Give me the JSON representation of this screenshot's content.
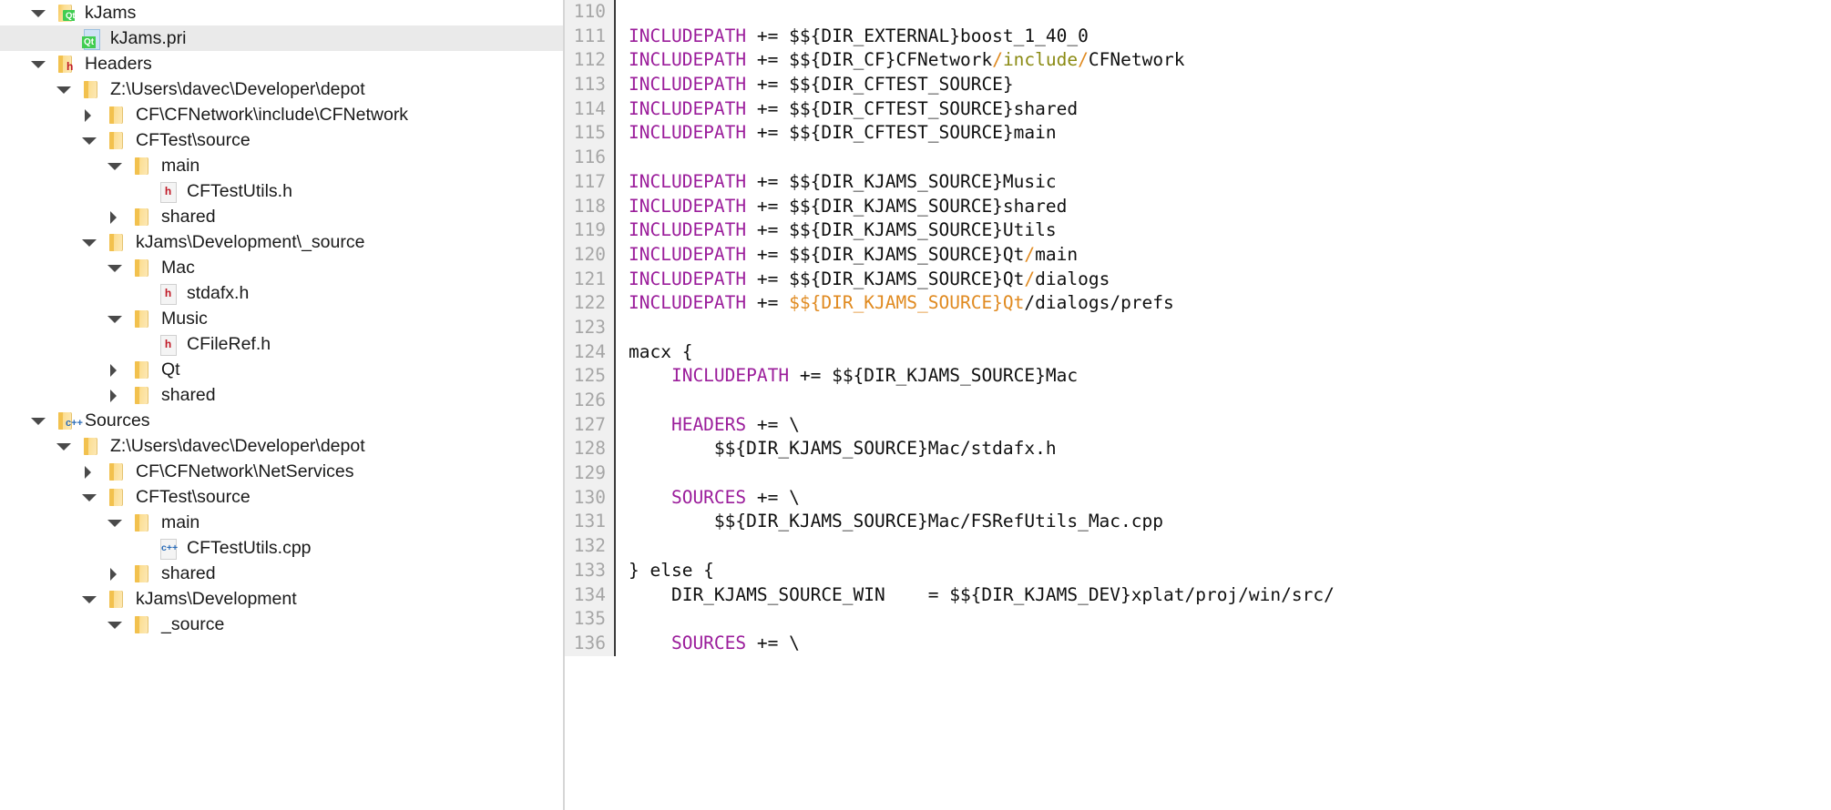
{
  "window": {
    "title": "kJams.pri - Qt Creator project tree and qmake editor"
  },
  "tree": {
    "name": "project-tree",
    "selected_item": "kJams.pri",
    "items": [
      {
        "label": "kJams",
        "depth": 1,
        "twisty": "open",
        "icon": "folder-qt",
        "badge": "Qt",
        "selected": false
      },
      {
        "label": "kJams.pri",
        "depth": 2,
        "twisty": "none",
        "icon": "file-qt",
        "badge": "Qt",
        "selected": true
      },
      {
        "label": "Headers",
        "depth": 1,
        "twisty": "open",
        "icon": "folder-h",
        "badge": "h",
        "selected": false
      },
      {
        "label": "Z:\\Users\\davec\\Developer\\depot",
        "depth": 2,
        "twisty": "open",
        "icon": "folder",
        "badge": "",
        "selected": false
      },
      {
        "label": "CF\\CFNetwork\\include\\CFNetwork",
        "depth": 3,
        "twisty": "closed",
        "icon": "folder",
        "badge": "",
        "selected": false
      },
      {
        "label": "CFTest\\source",
        "depth": 3,
        "twisty": "open",
        "icon": "folder",
        "badge": "",
        "selected": false
      },
      {
        "label": "main",
        "depth": 4,
        "twisty": "open",
        "icon": "folder",
        "badge": "",
        "selected": false
      },
      {
        "label": "CFTestUtils.h",
        "depth": 5,
        "twisty": "none",
        "icon": "file-h",
        "badge": "h",
        "selected": false
      },
      {
        "label": "shared",
        "depth": 4,
        "twisty": "closed",
        "icon": "folder",
        "badge": "",
        "selected": false
      },
      {
        "label": "kJams\\Development\\_source",
        "depth": 3,
        "twisty": "open",
        "icon": "folder",
        "badge": "",
        "selected": false
      },
      {
        "label": "Mac",
        "depth": 4,
        "twisty": "open",
        "icon": "folder",
        "badge": "",
        "selected": false
      },
      {
        "label": "stdafx.h",
        "depth": 5,
        "twisty": "none",
        "icon": "file-h",
        "badge": "h",
        "selected": false
      },
      {
        "label": "Music",
        "depth": 4,
        "twisty": "open",
        "icon": "folder",
        "badge": "",
        "selected": false
      },
      {
        "label": "CFileRef.h",
        "depth": 5,
        "twisty": "none",
        "icon": "file-h",
        "badge": "h",
        "selected": false
      },
      {
        "label": "Qt",
        "depth": 4,
        "twisty": "closed",
        "icon": "folder",
        "badge": "",
        "selected": false
      },
      {
        "label": "shared",
        "depth": 4,
        "twisty": "closed",
        "icon": "folder",
        "badge": "",
        "selected": false
      },
      {
        "label": "Sources",
        "depth": 1,
        "twisty": "open",
        "icon": "folder-cpp",
        "badge": "c++",
        "selected": false
      },
      {
        "label": "Z:\\Users\\davec\\Developer\\depot",
        "depth": 2,
        "twisty": "open",
        "icon": "folder",
        "badge": "",
        "selected": false
      },
      {
        "label": "CF\\CFNetwork\\NetServices",
        "depth": 3,
        "twisty": "closed",
        "icon": "folder",
        "badge": "",
        "selected": false
      },
      {
        "label": "CFTest\\source",
        "depth": 3,
        "twisty": "open",
        "icon": "folder",
        "badge": "",
        "selected": false
      },
      {
        "label": "main",
        "depth": 4,
        "twisty": "open",
        "icon": "folder",
        "badge": "",
        "selected": false
      },
      {
        "label": "CFTestUtils.cpp",
        "depth": 5,
        "twisty": "none",
        "icon": "file-cpp",
        "badge": "c++",
        "selected": false
      },
      {
        "label": "shared",
        "depth": 4,
        "twisty": "closed",
        "icon": "folder",
        "badge": "",
        "selected": false
      },
      {
        "label": "kJams\\Development",
        "depth": 3,
        "twisty": "open",
        "icon": "folder",
        "badge": "",
        "selected": false
      },
      {
        "label": "_source",
        "depth": 4,
        "twisty": "open",
        "icon": "folder",
        "badge": "",
        "selected": false
      }
    ]
  },
  "editor": {
    "name": "qmake-editor",
    "language": "qmake",
    "first_visible_line": 110,
    "lines": [
      {
        "n": "110",
        "tokens": []
      },
      {
        "n": "111",
        "tokens": [
          {
            "t": "INCLUDEPATH ",
            "c": "kw"
          },
          {
            "t": "+= ",
            "c": "op"
          },
          {
            "t": "$${DIR_EXTERNAL}boost_1_40_0",
            "c": "plain"
          }
        ]
      },
      {
        "n": "112",
        "tokens": [
          {
            "t": "INCLUDEPATH ",
            "c": "kw"
          },
          {
            "t": "+= ",
            "c": "op"
          },
          {
            "t": "$${DIR_CF}CFNetwork",
            "c": "plain"
          },
          {
            "t": "/",
            "c": "slash"
          },
          {
            "t": "include",
            "c": "olive"
          },
          {
            "t": "/",
            "c": "slash"
          },
          {
            "t": "CFNetwork",
            "c": "plain"
          }
        ]
      },
      {
        "n": "113",
        "tokens": [
          {
            "t": "INCLUDEPATH ",
            "c": "kw"
          },
          {
            "t": "+= ",
            "c": "op"
          },
          {
            "t": "$${DIR_CFTEST_SOURCE}",
            "c": "plain"
          }
        ]
      },
      {
        "n": "114",
        "tokens": [
          {
            "t": "INCLUDEPATH ",
            "c": "kw"
          },
          {
            "t": "+= ",
            "c": "op"
          },
          {
            "t": "$${DIR_CFTEST_SOURCE}shared",
            "c": "plain"
          }
        ]
      },
      {
        "n": "115",
        "tokens": [
          {
            "t": "INCLUDEPATH ",
            "c": "kw"
          },
          {
            "t": "+= ",
            "c": "op"
          },
          {
            "t": "$${DIR_CFTEST_SOURCE}main",
            "c": "plain"
          }
        ]
      },
      {
        "n": "116",
        "tokens": []
      },
      {
        "n": "117",
        "tokens": [
          {
            "t": "INCLUDEPATH ",
            "c": "kw"
          },
          {
            "t": "+= ",
            "c": "op"
          },
          {
            "t": "$${DIR_KJAMS_SOURCE}Music",
            "c": "plain"
          }
        ]
      },
      {
        "n": "118",
        "tokens": [
          {
            "t": "INCLUDEPATH ",
            "c": "kw"
          },
          {
            "t": "+= ",
            "c": "op"
          },
          {
            "t": "$${DIR_KJAMS_SOURCE}shared",
            "c": "plain"
          }
        ]
      },
      {
        "n": "119",
        "tokens": [
          {
            "t": "INCLUDEPATH ",
            "c": "kw"
          },
          {
            "t": "+= ",
            "c": "op"
          },
          {
            "t": "$${DIR_KJAMS_SOURCE}Utils",
            "c": "plain"
          }
        ]
      },
      {
        "n": "120",
        "tokens": [
          {
            "t": "INCLUDEPATH ",
            "c": "kw"
          },
          {
            "t": "+= ",
            "c": "op"
          },
          {
            "t": "$${DIR_KJAMS_SOURCE}Qt",
            "c": "plain"
          },
          {
            "t": "/",
            "c": "slash"
          },
          {
            "t": "main",
            "c": "plain"
          }
        ]
      },
      {
        "n": "121",
        "tokens": [
          {
            "t": "INCLUDEPATH ",
            "c": "kw"
          },
          {
            "t": "+= ",
            "c": "op"
          },
          {
            "t": "$${DIR_KJAMS_SOURCE}Qt",
            "c": "plain"
          },
          {
            "t": "/",
            "c": "slash"
          },
          {
            "t": "dialogs",
            "c": "plain"
          }
        ]
      },
      {
        "n": "122",
        "tokens": [
          {
            "t": "INCLUDEPATH ",
            "c": "kw"
          },
          {
            "t": "+= ",
            "c": "op"
          },
          {
            "t": "$${DIR_KJAMS_SOURCE}Qt",
            "c": "slash"
          },
          {
            "t": "/dialogs/prefs",
            "c": "plain"
          }
        ]
      },
      {
        "n": "123",
        "tokens": []
      },
      {
        "n": "124",
        "tokens": [
          {
            "t": "macx {",
            "c": "plain"
          }
        ]
      },
      {
        "n": "125",
        "tokens": [
          {
            "t": "    INCLUDEPATH ",
            "c": "kw"
          },
          {
            "t": "+= ",
            "c": "op"
          },
          {
            "t": "$${DIR_KJAMS_SOURCE}Mac",
            "c": "plain"
          }
        ]
      },
      {
        "n": "126",
        "tokens": []
      },
      {
        "n": "127",
        "tokens": [
          {
            "t": "    HEADERS ",
            "c": "kw"
          },
          {
            "t": "+= \\",
            "c": "op"
          }
        ]
      },
      {
        "n": "128",
        "tokens": [
          {
            "t": "        $${DIR_KJAMS_SOURCE}Mac/stdafx.h",
            "c": "plain"
          }
        ]
      },
      {
        "n": "129",
        "tokens": []
      },
      {
        "n": "130",
        "tokens": [
          {
            "t": "    SOURCES ",
            "c": "kw"
          },
          {
            "t": "+= \\",
            "c": "op"
          }
        ]
      },
      {
        "n": "131",
        "tokens": [
          {
            "t": "        $${DIR_KJAMS_SOURCE}Mac/FSRefUtils_Mac.cpp",
            "c": "plain"
          }
        ]
      },
      {
        "n": "132",
        "tokens": []
      },
      {
        "n": "133",
        "tokens": [
          {
            "t": "} else {",
            "c": "plain"
          }
        ]
      },
      {
        "n": "134",
        "tokens": [
          {
            "t": "    DIR_KJAMS_SOURCE_WIN    = $${DIR_KJAMS_DEV}xplat/proj/win/src/",
            "c": "plain"
          }
        ]
      },
      {
        "n": "135",
        "tokens": []
      },
      {
        "n": "136",
        "tokens": [
          {
            "t": "    SOURCES ",
            "c": "kw"
          },
          {
            "t": "+= \\",
            "c": "op"
          }
        ]
      }
    ]
  },
  "colors": {
    "keyword": "#9b1d9b",
    "plain": "#101010",
    "slash": "#e08a20",
    "olive": "#8a8a12",
    "gutter_bg": "#f0f0f0",
    "gutter_fg": "#a6a6a6",
    "selection_bg": "#eaeaea",
    "folder": "#f2c14e"
  }
}
